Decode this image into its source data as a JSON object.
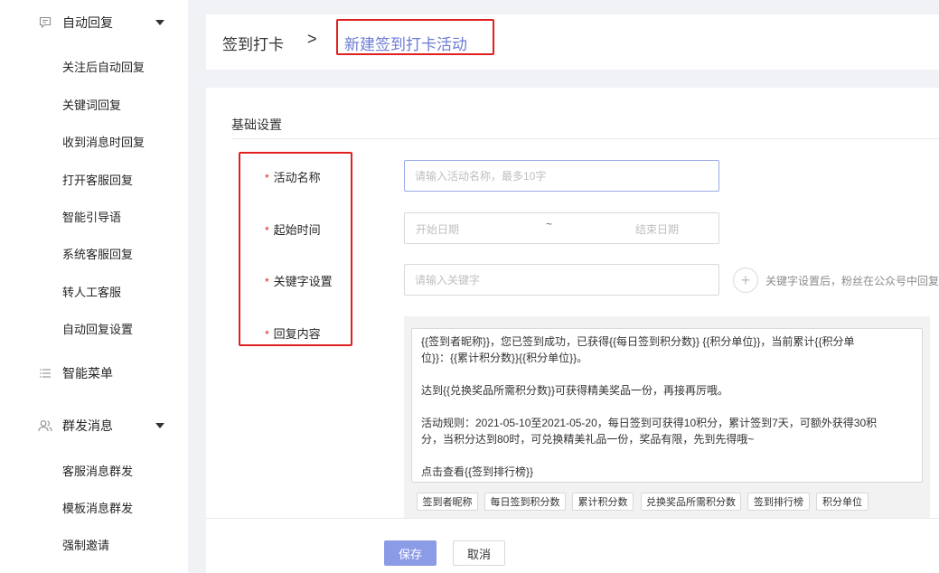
{
  "sidebar": {
    "group_auto_reply": "自动回复",
    "auto_reply_items": [
      "关注后自动回复",
      "关键词回复",
      "收到消息时回复",
      "打开客服回复",
      "智能引导语",
      "系统客服回复",
      "转人工客服",
      "自动回复设置"
    ],
    "smart_menu": "智能菜单",
    "group_broadcast": "群发消息",
    "broadcast_items": [
      "客服消息群发",
      "模板消息群发",
      "强制邀请"
    ]
  },
  "breadcrumb": {
    "root": "签到打卡",
    "separator": ">",
    "current": "新建签到打卡活动"
  },
  "form": {
    "section_title": "基础设置",
    "required_mark": "*",
    "labels": {
      "name": "活动名称",
      "time": "起始时间",
      "keyword": "关键字设置",
      "reply": "回复内容"
    },
    "name_placeholder": "请输入活动名称，最多10字",
    "date_start_placeholder": "开始日期",
    "date_separator": "~",
    "date_end_placeholder": "结束日期",
    "keyword_placeholder": "请输入关键字",
    "keyword_add": "+",
    "keyword_hint": "关键字设置后，粉丝在公众号中回复",
    "reply_lines": [
      "{{签到者昵称}}，您已签到成功，已获得{{每日签到积分数}} {{积分单位}}，当前累计{{积分单",
      "位}}：{{累计积分数}}{{积分单位}}。",
      "达到{{兑换奖品所需积分数}}可获得精美奖品一份，再接再厉哦。",
      "活动规则：2021-05-10至2021-05-20，每日签到可获得10积分，累计签到7天，可额外获得30积",
      "分，当积分达到80时，可兑换精美礼品一份，奖品有限，先到先得哦~",
      "点击查看{{签到排行榜}}"
    ],
    "tags": [
      "签到者昵称",
      "每日签到积分数",
      "累计积分数",
      "兑换奖品所需积分数",
      "签到排行榜",
      "积分单位"
    ]
  },
  "footer": {
    "save": "保存",
    "cancel": "取消"
  },
  "colors": {
    "accent": "#6b7bd4",
    "save_button": "#8c9be6",
    "highlight_box": "#e02020",
    "required": "#e02020"
  }
}
